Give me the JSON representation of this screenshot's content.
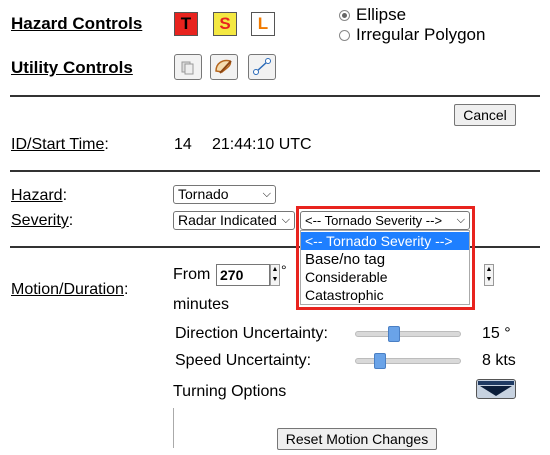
{
  "hazard_controls": {
    "label": "Hazard Controls",
    "buttons": [
      {
        "letter": "T",
        "bg": "#e8231e",
        "fg": "#000000"
      },
      {
        "letter": "S",
        "bg": "#f4e842",
        "fg": "#e8231e"
      },
      {
        "letter": "L",
        "bg": "#ffffff",
        "fg": "#f07a00"
      }
    ]
  },
  "utility_controls": {
    "label": "Utility Controls"
  },
  "shape": {
    "options": [
      "Ellipse",
      "Irregular Polygon"
    ],
    "selected": "Ellipse"
  },
  "cancel_label": "Cancel",
  "id_start": {
    "label": "ID/Start Time",
    "id": "14",
    "time": "21:44:10 UTC"
  },
  "hazard": {
    "label": "Hazard",
    "value": "Tornado"
  },
  "severity": {
    "label": "Severity",
    "value": "Radar Indicated",
    "tornado_severity_value": "<-- Tornado Severity -->",
    "options": [
      "<-- Tornado Severity -->",
      "Base/no tag",
      "Considerable",
      "Catastrophic"
    ],
    "highlighted": "<-- Tornado Severity -->"
  },
  "motion": {
    "label": "Motion/Duration",
    "from_label": "From",
    "from_value": "270",
    "degree": "°",
    "minutes_label": "minutes",
    "direction_label": "Direction Uncertainty:",
    "direction_value": "15 °",
    "direction_level": 0.35,
    "speed_label": "Speed Uncertainty:",
    "speed_value": "8 kts",
    "speed_level": 0.2,
    "turning_label": "Turning Options"
  },
  "reset_label": "Reset Motion Changes",
  "colors": {
    "highlight_box": "#e8231e",
    "selected_option": "#1e7fff"
  }
}
